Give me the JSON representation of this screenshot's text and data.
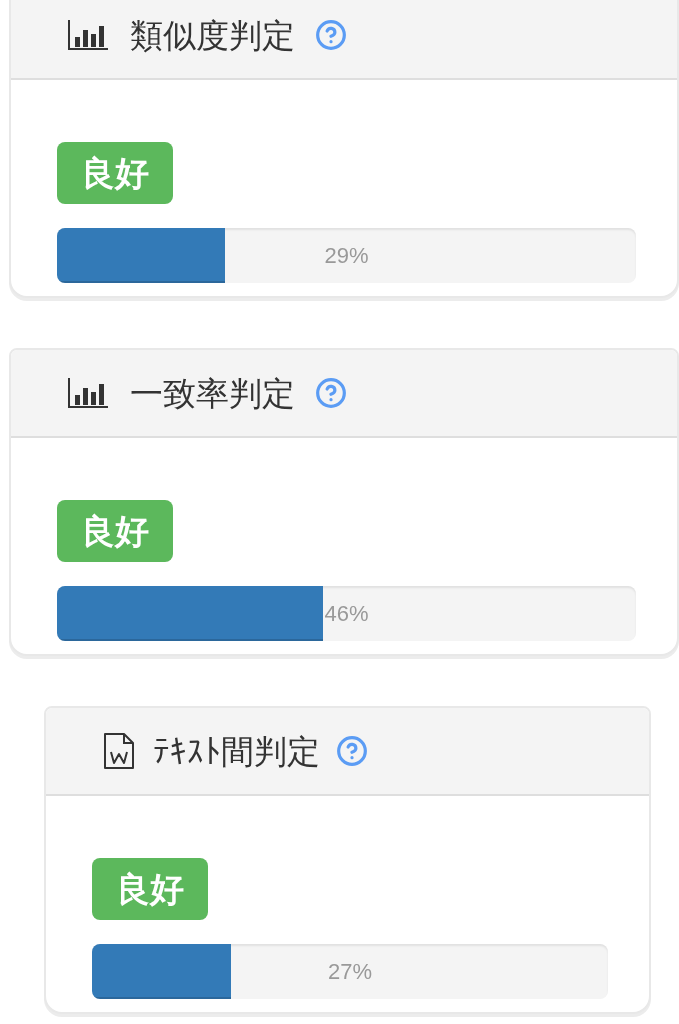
{
  "cards": [
    {
      "kind": "chart",
      "title": "類似度判定",
      "badge": "良好",
      "level": 0.29,
      "reading": "29%"
    },
    {
      "kind": "chart",
      "title": "一致率判定",
      "badge": "良好",
      "level": 0.46,
      "reading": "46%"
    },
    {
      "kind": "document",
      "title": "ﾃｷｽﾄ間判定",
      "badge": "良好",
      "level": 0.27,
      "reading": "27%"
    }
  ]
}
